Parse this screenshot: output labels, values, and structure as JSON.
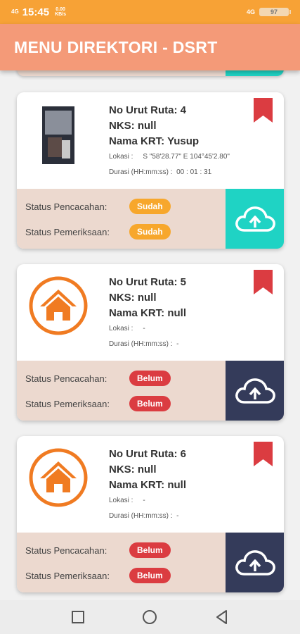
{
  "status_bar": {
    "network": "4G",
    "time": "15:45",
    "speed": "0.00 KB/s",
    "network_right": "4G",
    "battery": "97"
  },
  "app_bar": {
    "title": "MENU DIREKTORI - DSRT"
  },
  "colors": {
    "status_bar": "#f7a236",
    "app_bar": "#f49a78",
    "badge_sudah": "#f7a72c",
    "badge_belum": "#db3c41",
    "upload_done": "#1fd3c4",
    "upload_pending": "#343b5a",
    "bookmark": "#db3c41",
    "house": "#f07b22"
  },
  "cards": [
    {
      "no_urut": "No Urut Ruta: 4",
      "nks": "NKS: null",
      "nama_krt": "Nama KRT: Yusup",
      "lokasi_label": "Lokasi :",
      "lokasi_value": "S \"58'28.77\" E 104°45'2.80\"",
      "durasi_label": "Durasi (HH:mm:ss) :",
      "durasi_value": "00 : 01 : 31",
      "status_pencacahan_label": "Status Pencacahan:",
      "status_pencacahan": "Sudah",
      "status_pemeriksaan_label": "Status Pemeriksaan:",
      "status_pemeriksaan": "Sudah",
      "image": "photo-thumbnail",
      "upload_icon": "cloud-upload-icon"
    },
    {
      "no_urut": "No Urut Ruta: 5",
      "nks": "NKS: null",
      "nama_krt": "Nama KRT: null",
      "lokasi_label": "Lokasi :",
      "lokasi_value": "-",
      "durasi_label": "Durasi (HH:mm:ss) :",
      "durasi_value": "-",
      "status_pencacahan_label": "Status Pencacahan:",
      "status_pencacahan": "Belum",
      "status_pemeriksaan_label": "Status Pemeriksaan:",
      "status_pemeriksaan": "Belum",
      "image": "house-icon",
      "upload_icon": "cloud-upload-icon"
    },
    {
      "no_urut": "No Urut Ruta: 6",
      "nks": "NKS: null",
      "nama_krt": "Nama KRT: null",
      "lokasi_label": "Lokasi :",
      "lokasi_value": "-",
      "durasi_label": "Durasi (HH:mm:ss) :",
      "durasi_value": "-",
      "status_pencacahan_label": "Status Pencacahan:",
      "status_pencacahan": "Belum",
      "status_pemeriksaan_label": "Status Pemeriksaan:",
      "status_pemeriksaan": "Belum",
      "image": "house-icon",
      "upload_icon": "cloud-upload-icon"
    }
  ],
  "nav_bar": {
    "icons": [
      "square-recents-icon",
      "circle-home-icon",
      "triangle-back-icon"
    ]
  }
}
